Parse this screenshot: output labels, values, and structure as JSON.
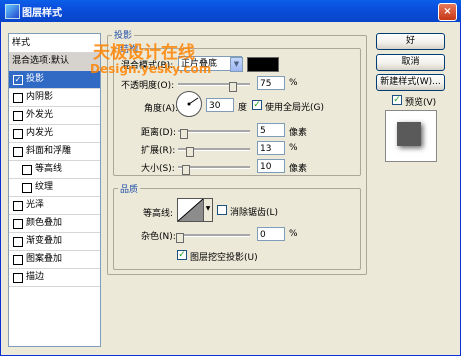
{
  "window": {
    "title": "图层样式",
    "close": "×"
  },
  "sidebar": {
    "header": "样式",
    "items": [
      {
        "label": "混合选项:默认",
        "checkbox": false
      },
      {
        "label": "投影",
        "checkbox": true,
        "checked": true
      },
      {
        "label": "内阴影",
        "checkbox": true
      },
      {
        "label": "外发光",
        "checkbox": true
      },
      {
        "label": "内发光",
        "checkbox": true
      },
      {
        "label": "斜面和浮雕",
        "checkbox": true
      },
      {
        "label": "等高线",
        "checkbox": true,
        "indent": true
      },
      {
        "label": "纹理",
        "checkbox": true,
        "indent": true
      },
      {
        "label": "光泽",
        "checkbox": true
      },
      {
        "label": "颜色叠加",
        "checkbox": true
      },
      {
        "label": "渐变叠加",
        "checkbox": true
      },
      {
        "label": "图案叠加",
        "checkbox": true
      },
      {
        "label": "描边",
        "checkbox": true
      }
    ]
  },
  "watermark": {
    "line1": "天极设计在线",
    "line2": "Design.yesky.com"
  },
  "shadow": {
    "group_title": "投影",
    "structure_title": "结构",
    "blend_mode_label": "混合模式(B):",
    "blend_mode_value": "正片叠底",
    "opacity_label": "不透明度(O):",
    "opacity_value": "75",
    "percent": "%",
    "angle_label": "角度(A):",
    "angle_value": "30",
    "degree_unit": "度",
    "global_light_label": "使用全局光(G)",
    "distance_label": "距离(D):",
    "distance_value": "5",
    "spread_label": "扩展(R):",
    "spread_value": "13",
    "size_label": "大小(S):",
    "size_value": "10",
    "pixel_unit": "像素",
    "quality_title": "品质",
    "contour_label": "等高线:",
    "antialias_label": "消除锯齿(L)",
    "noise_label": "杂色(N):",
    "noise_value": "0",
    "knockout_label": "图层挖空投影(U)"
  },
  "buttons": {
    "ok": "好",
    "cancel": "取消",
    "new_style": "新建样式(W)...",
    "preview_label": "预览(V)"
  },
  "colors": {
    "shadow_swatch": "#000000",
    "titlebar": "#0A4EDC",
    "selection": "#316AC5"
  }
}
